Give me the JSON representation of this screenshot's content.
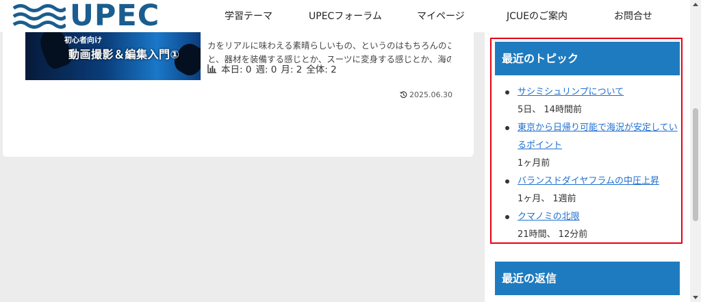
{
  "header": {
    "logo_text": "UPEC",
    "nav": [
      "学習テーマ",
      "UPECフォーラム",
      "マイページ",
      "JCUEのご案内",
      "お問合せ"
    ],
    "brand_color": "#1b5d8f"
  },
  "post": {
    "thumb_subtitle": "初心者向け",
    "thumb_title": "動画撮影＆編集入門①",
    "excerpt_lines": [
      "カをリアルに味わえる素晴らしいもの、というのはもちろんのこ",
      "と、器材を装備する感じとか、スーツに変身する感じとか、海の…"
    ],
    "stats": {
      "icon": "bar-chart-icon",
      "today": "本日: 0",
      "week": "週: 0",
      "month": "月: 2",
      "total": "全体: 2"
    },
    "date": "2025.06.30",
    "date_icon": "history-icon"
  },
  "sidebar": {
    "recent_topics": {
      "title": "最近のトピック",
      "items": [
        {
          "title": "サシミシュリンプについて",
          "time": "5日、 14時間前"
        },
        {
          "title_lines": [
            "東京から日帰り可能で海況が安定してい",
            "るポイント"
          ],
          "time": "1ヶ月前"
        },
        {
          "title": "バランスドダイヤフラムの中圧上昇",
          "time": "1ヶ月、 1週前"
        },
        {
          "title": "クマノミの北限",
          "time": "21時間、 12分前"
        }
      ]
    },
    "recent_replies": {
      "title": "最近の返信"
    },
    "header_color": "#1f7bbf",
    "highlight_color": "#e60012"
  }
}
